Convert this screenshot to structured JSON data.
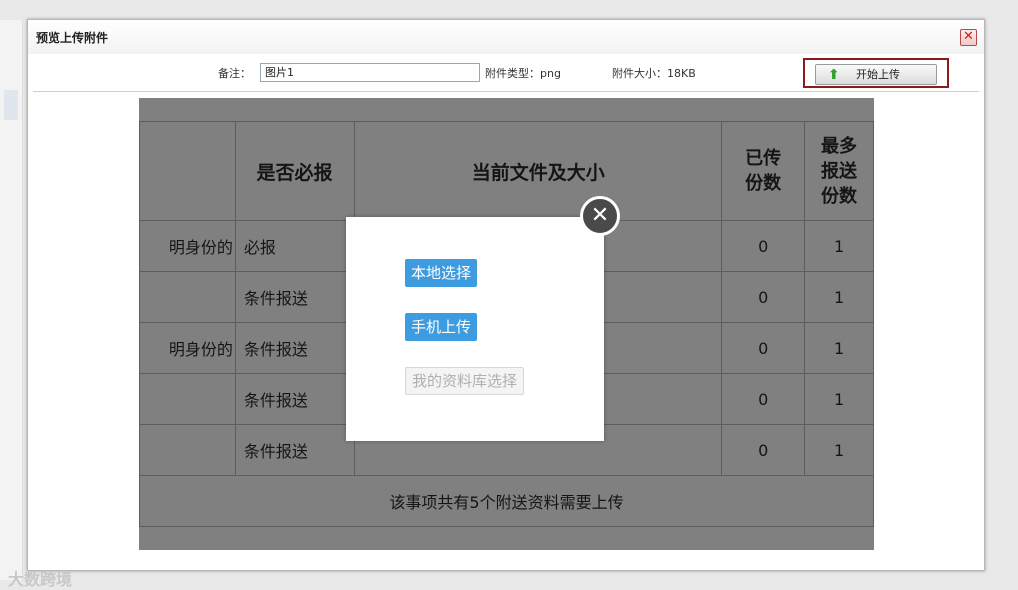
{
  "background": {
    "watermark": "大数跨境"
  },
  "dialog": {
    "title": "预览上传附件",
    "close_icon": "close-icon",
    "remark_label": "备注：",
    "remark_value": "图片1",
    "file_type": "附件类型：png",
    "file_size": "附件大小：18KB",
    "upload_button": "开始上传"
  },
  "table": {
    "headers": [
      "",
      "是否必报",
      "当前文件及大小",
      "已传份数",
      "最多报送份数"
    ],
    "rows": [
      {
        "name": "明身份的",
        "required": "必报",
        "uploaded": "0",
        "max": "1"
      },
      {
        "name": "",
        "required": "条件报送",
        "uploaded": "0",
        "max": "1"
      },
      {
        "name": "明身份的",
        "required": "条件报送",
        "uploaded": "0",
        "max": "1"
      },
      {
        "name": "",
        "required": "条件报送",
        "uploaded": "0",
        "max": "1"
      },
      {
        "name": "",
        "required": "条件报送",
        "uploaded": "0",
        "max": "1"
      }
    ],
    "summary": "该事项共有5个附送资料需要上传"
  },
  "modal": {
    "local_select": "本地选择",
    "mobile_upload": "手机上传",
    "library_select": "我的资料库选择"
  },
  "colors": {
    "accent": "#3d9be0",
    "highlight_border": "#8b1a1a",
    "overlay": "#808080"
  }
}
